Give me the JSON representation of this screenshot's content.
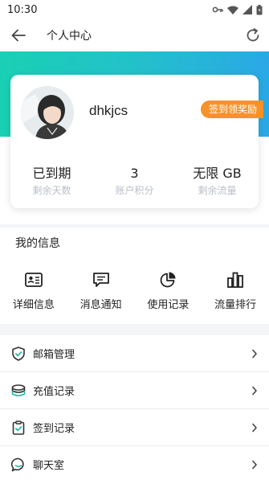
{
  "status_bar": {
    "time": "10:30"
  },
  "header": {
    "title": "个人中心"
  },
  "profile": {
    "username": "dhkjcs",
    "reward_button": "签到领奖励",
    "stats": [
      {
        "value": "已到期",
        "label": "剩余天数"
      },
      {
        "value": "3",
        "label": "账户积分"
      },
      {
        "value": "无限 GB",
        "label": "剩余流量"
      }
    ]
  },
  "my_info": {
    "title": "我的信息",
    "items": [
      {
        "label": "详细信息",
        "icon": "id-card-icon"
      },
      {
        "label": "消息通知",
        "icon": "message-icon"
      },
      {
        "label": "使用记录",
        "icon": "pie-chart-icon"
      },
      {
        "label": "流量排行",
        "icon": "bar-chart-icon"
      }
    ]
  },
  "menu": [
    {
      "label": "邮箱管理",
      "icon": "shield-check-icon"
    },
    {
      "label": "充值记录",
      "icon": "coins-icon"
    },
    {
      "label": "签到记录",
      "icon": "clipboard-check-icon"
    },
    {
      "label": "聊天室",
      "icon": "chat-bubble-icon"
    }
  ],
  "colors": {
    "accent_gradient_start": "#19d0b4",
    "accent_gradient_end": "#2aa8e6",
    "reward_orange": "#f5932a",
    "muted_label": "#b9c0c8"
  }
}
